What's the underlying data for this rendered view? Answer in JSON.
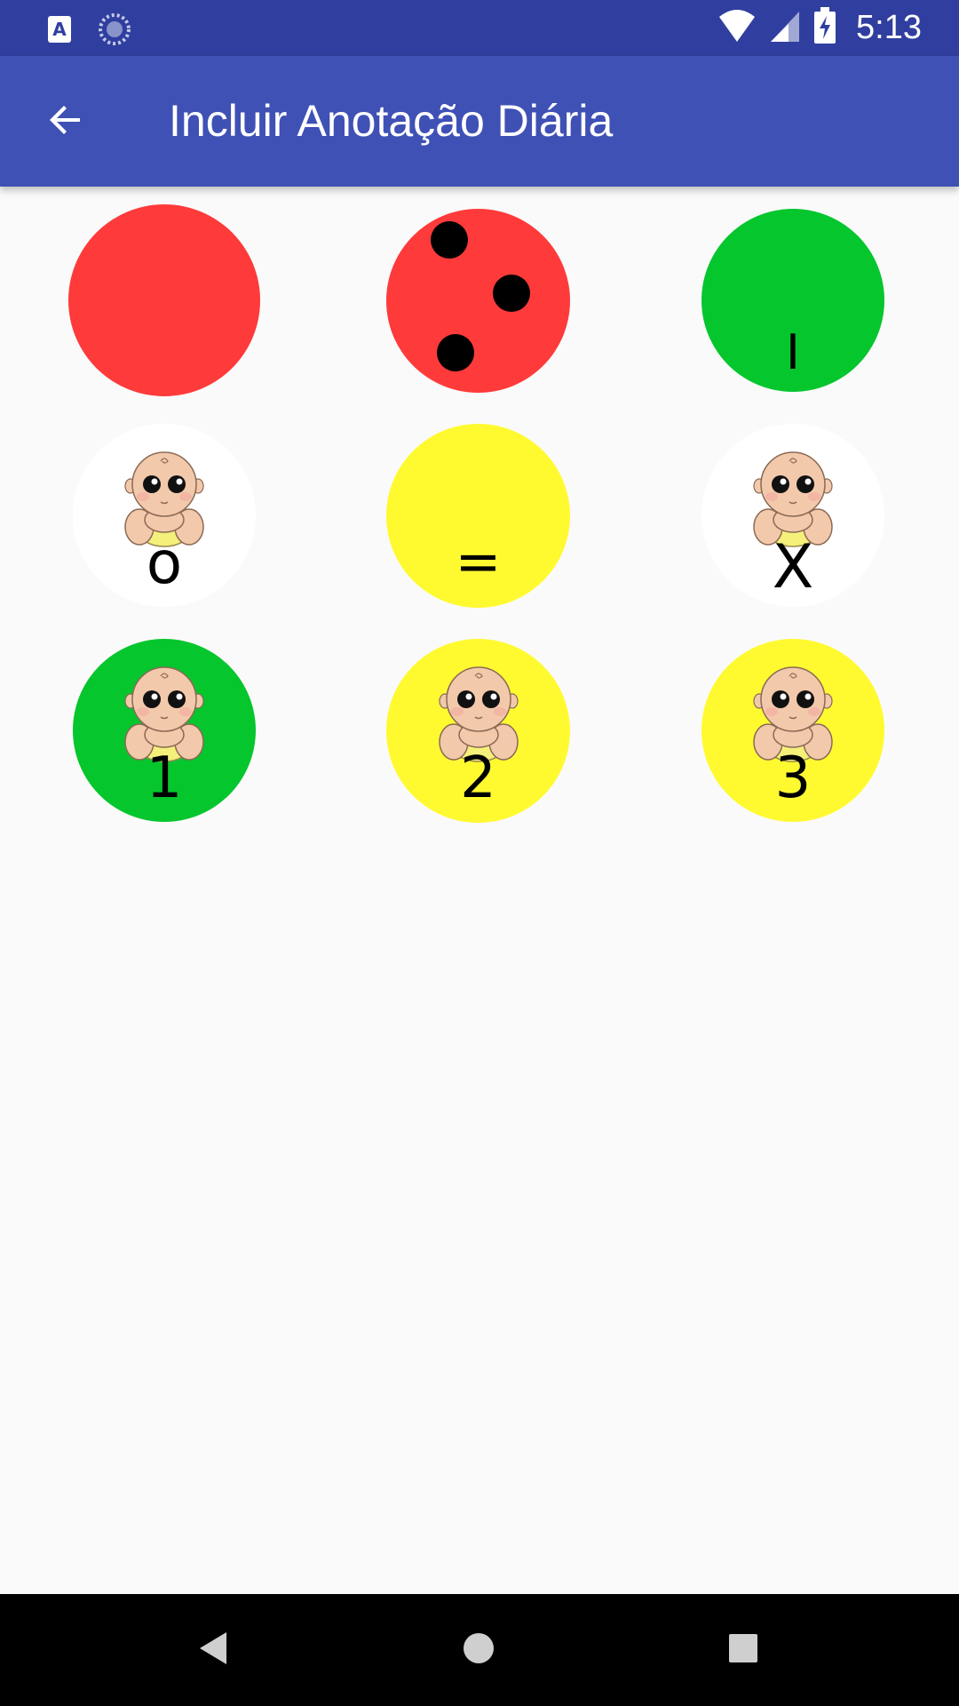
{
  "status_bar": {
    "time": "5:13",
    "left_icons": [
      "app-a-icon",
      "sync-icon"
    ],
    "right_icons": [
      "wifi-icon",
      "signal-icon",
      "battery-icon"
    ]
  },
  "app_bar": {
    "title": "Incluir Anotação Diária",
    "back_icon": "arrow-back-icon"
  },
  "options": [
    {
      "id": "red-plain",
      "color": "#fe3a3a",
      "symbol": "",
      "baby": false
    },
    {
      "id": "red-dots",
      "color": "#fe3a3a",
      "symbol": "",
      "baby": false,
      "dots": 3
    },
    {
      "id": "green-bar",
      "color": "#05c62d",
      "symbol": "I",
      "baby": false
    },
    {
      "id": "baby-o",
      "color": "#ffffff",
      "symbol": "o",
      "baby": true
    },
    {
      "id": "yellow-equals",
      "color": "#fffa30",
      "symbol": "=",
      "baby": false
    },
    {
      "id": "baby-x",
      "color": "#ffffff",
      "symbol": "X",
      "baby": true
    },
    {
      "id": "baby-1",
      "color": "#05c62d",
      "symbol": "1",
      "baby": true
    },
    {
      "id": "baby-2",
      "color": "#fffa30",
      "symbol": "2",
      "baby": true
    },
    {
      "id": "baby-3",
      "color": "#fffa30",
      "symbol": "3",
      "baby": true
    }
  ],
  "nav_bar": {
    "back_icon": "nav-back-icon",
    "home_icon": "nav-home-icon",
    "recents_icon": "nav-recents-icon"
  },
  "colors": {
    "status_bar": "#303f9f",
    "app_bar": "#3f51b5",
    "background": "#fafafa"
  }
}
